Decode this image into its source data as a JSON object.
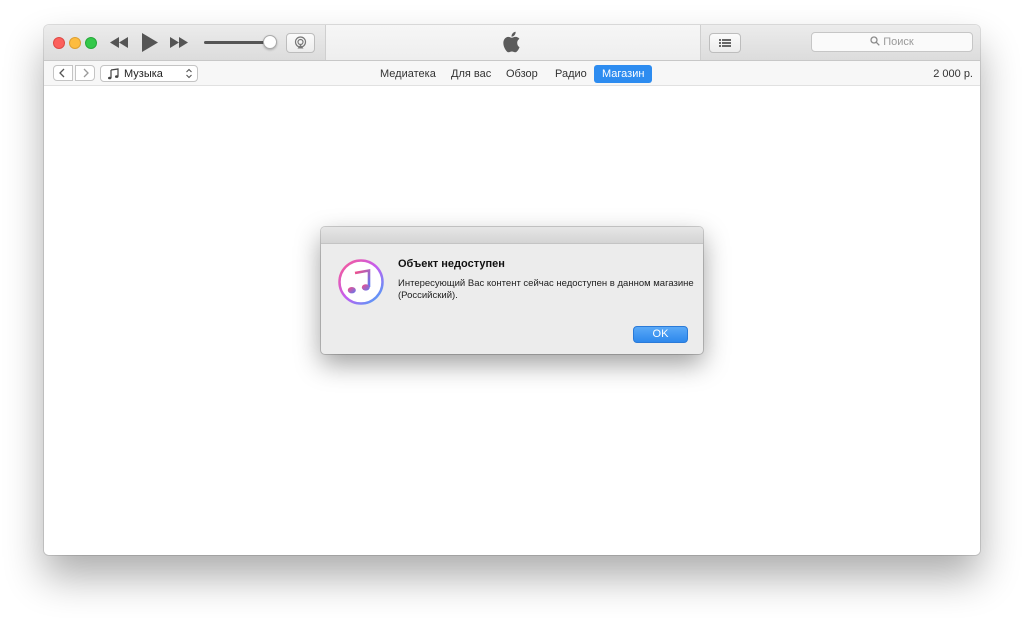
{
  "toolbar": {
    "rewind_icon": "rewind-icon",
    "play_icon": "play-icon",
    "forward_icon": "fast-forward-icon",
    "volume_level": 0.9,
    "search_placeholder": "Поиск"
  },
  "navbar": {
    "media_kind": "Музыка",
    "tabs": [
      {
        "label": "Медиатека",
        "active": false
      },
      {
        "label": "Для вас",
        "active": false
      },
      {
        "label": "Обзор",
        "active": false
      },
      {
        "label": "Радио",
        "active": false
      },
      {
        "label": "Магазин",
        "active": true
      }
    ],
    "balance": "2 000 р."
  },
  "dialog": {
    "title": "Объект недоступен",
    "message": "Интересующий Вас контент сейчас недоступен в данном магазине (Российский).",
    "ok_label": "OK"
  },
  "colors": {
    "accent": "#2d8cf0",
    "close": "#fc605c",
    "minimize": "#fdbc40",
    "zoom": "#34c84a"
  }
}
